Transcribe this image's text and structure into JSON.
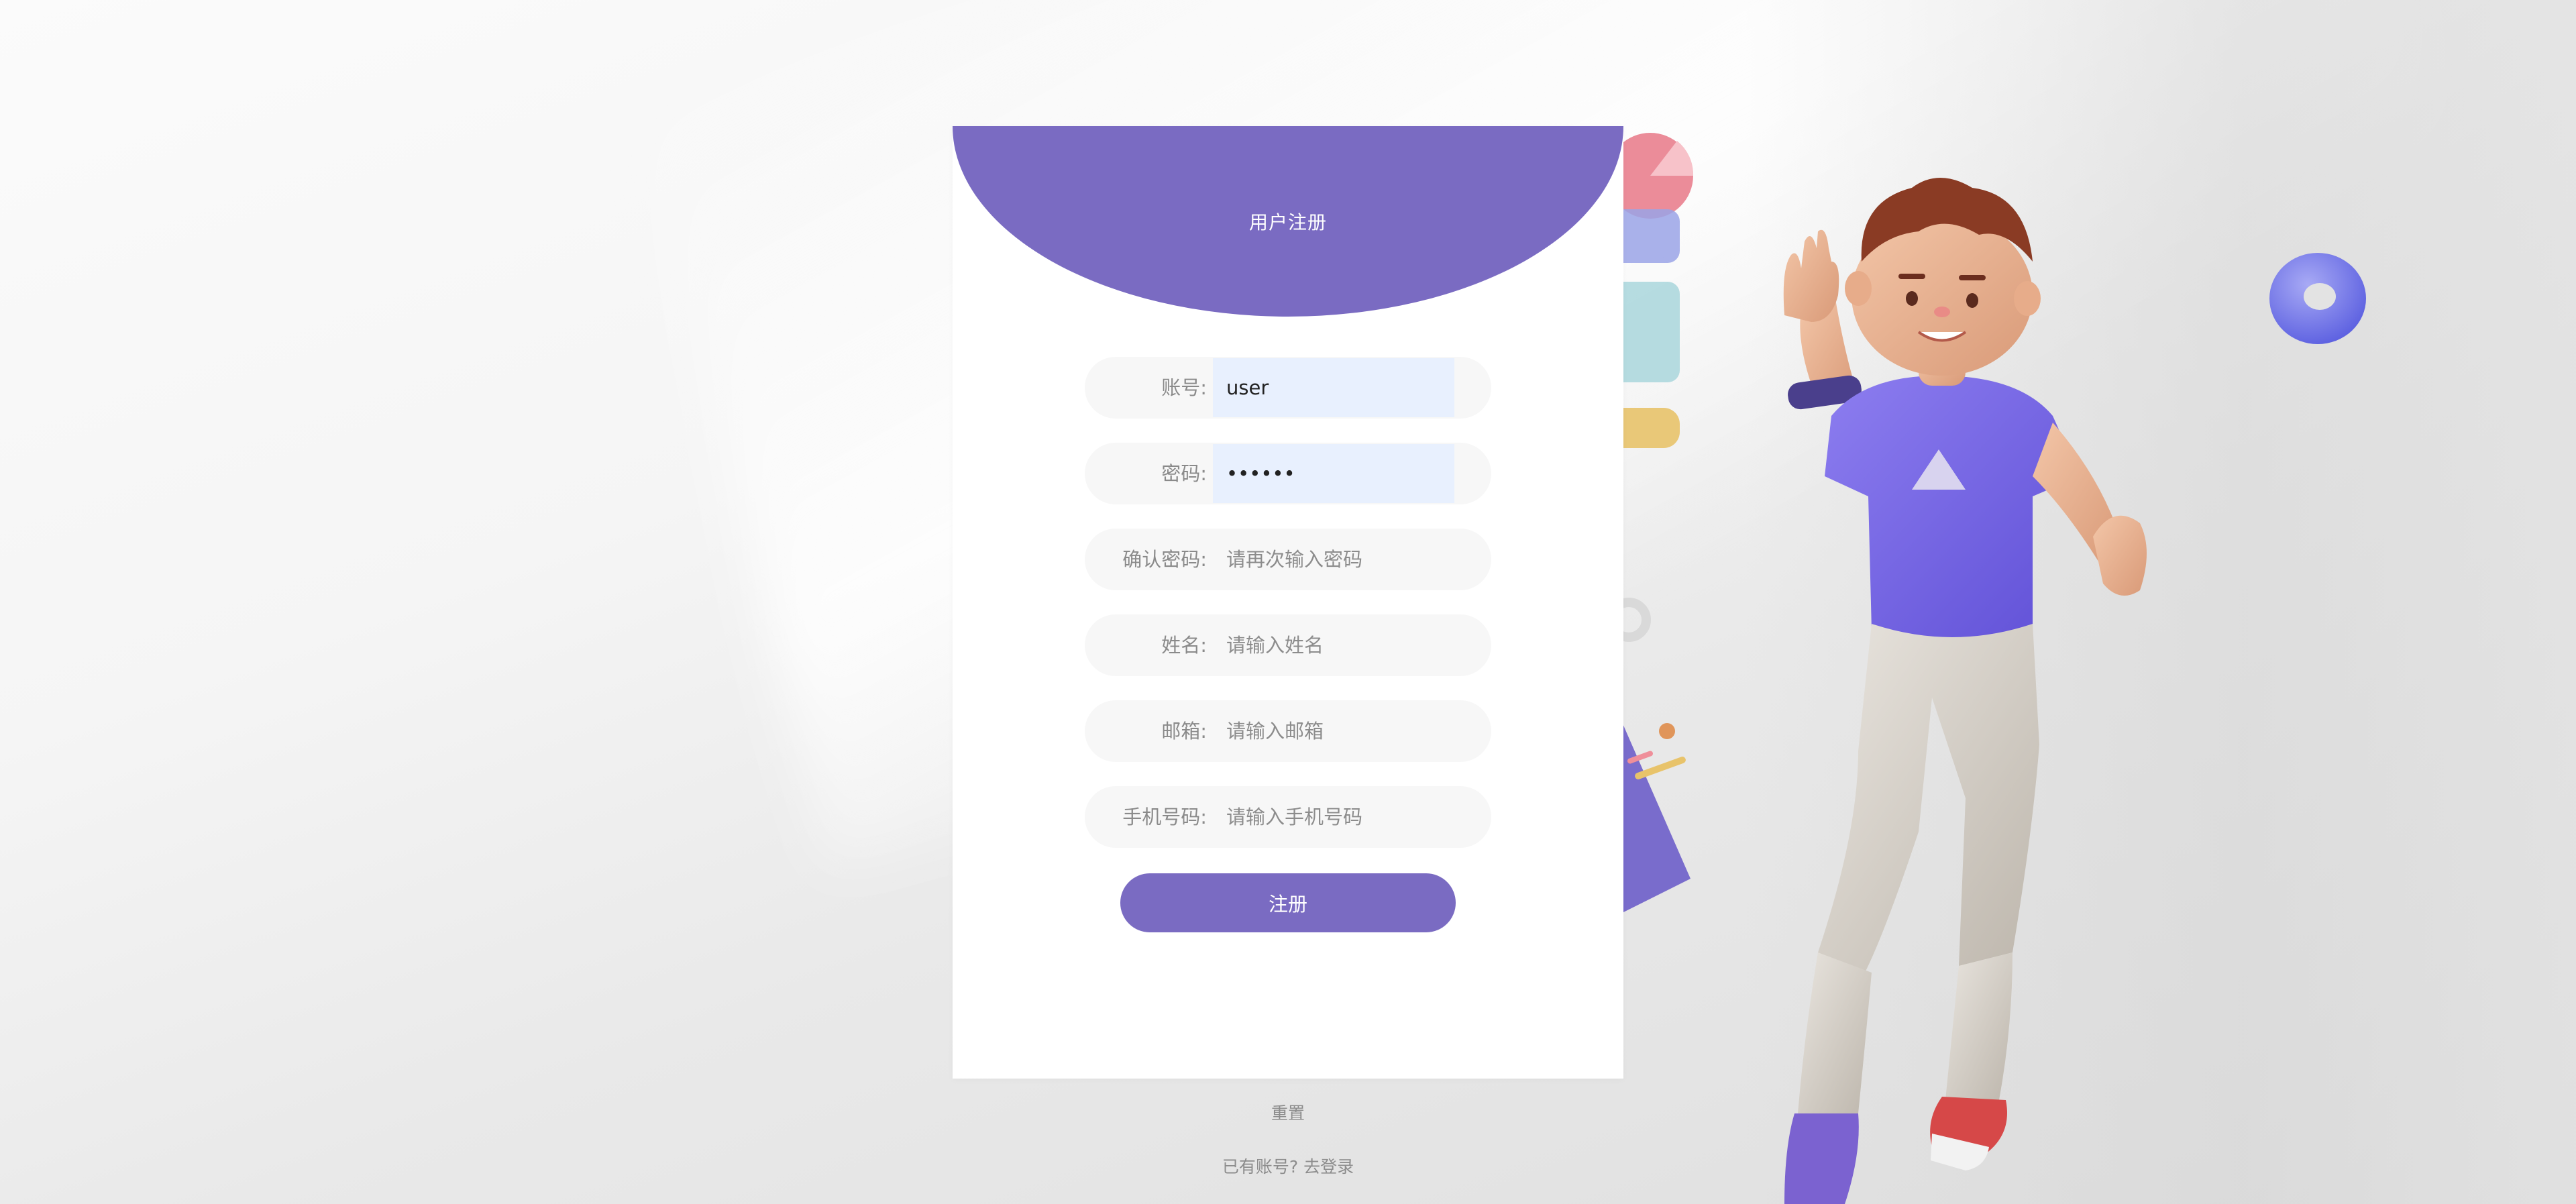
{
  "page": {
    "title": "用户注册"
  },
  "form": {
    "account": {
      "label": "账号:",
      "value": "user",
      "placeholder": ""
    },
    "password": {
      "label": "密码:",
      "value": "••••••",
      "placeholder": ""
    },
    "confirm_password": {
      "label": "确认密码:",
      "value": "",
      "placeholder": "请再次输入密码"
    },
    "name": {
      "label": "姓名:",
      "value": "",
      "placeholder": "请输入姓名"
    },
    "email": {
      "label": "邮箱:",
      "value": "",
      "placeholder": "请输入邮箱"
    },
    "phone": {
      "label": "手机号码:",
      "value": "",
      "placeholder": "请输入手机号码"
    }
  },
  "actions": {
    "submit_label": "注册",
    "reset_label": "重置",
    "login_link": "已有账号? 去登录"
  },
  "colors": {
    "accent": "#7a6bc2",
    "field_bg": "#f7f7f7",
    "autofill_bg": "#e8f0fe"
  },
  "illustration": {
    "icon": "character-3d-illustration",
    "shirt_logo": "triangle-logo-icon",
    "decorations": [
      "pie-icon",
      "ring-icon",
      "donut-icon",
      "sparkles-icon"
    ]
  }
}
